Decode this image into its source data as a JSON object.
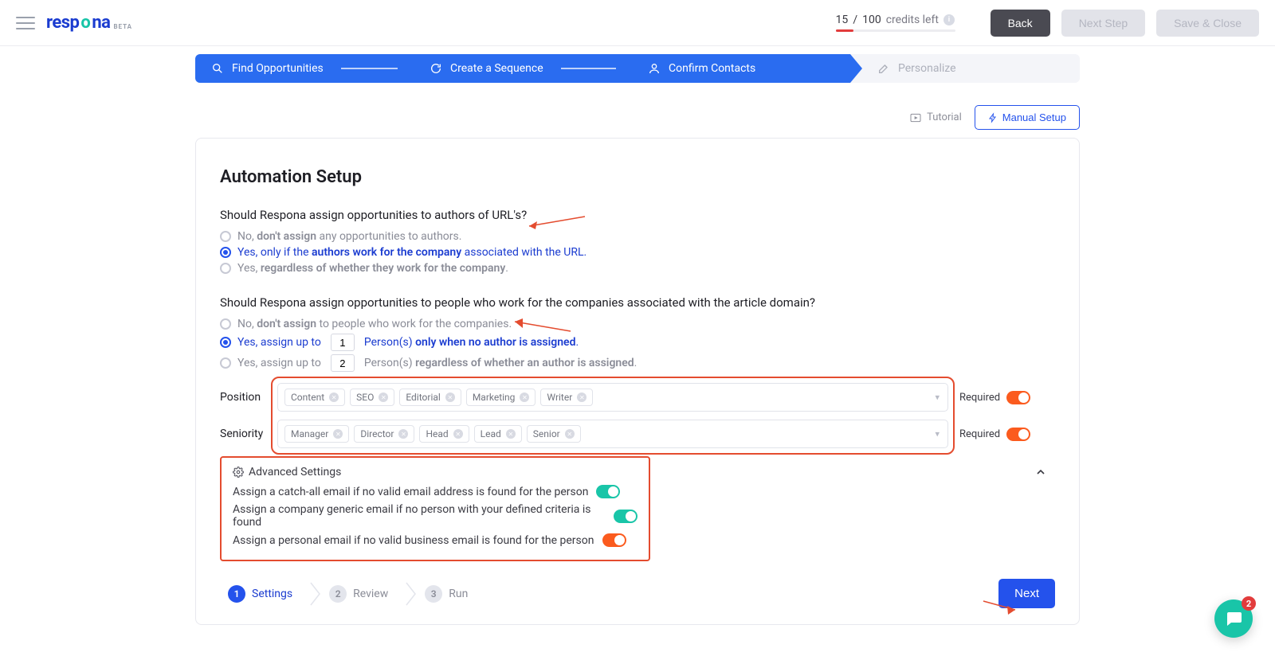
{
  "header": {
    "logo_beta": "BETA",
    "credits_used": "15",
    "credits_total": "100",
    "credits_suffix": "credits left",
    "credits_pct": 15,
    "buttons": {
      "back": "Back",
      "next_step": "Next Step",
      "save_close": "Save & Close"
    }
  },
  "progress": {
    "steps": [
      {
        "label": "Find Opportunities"
      },
      {
        "label": "Create a Sequence"
      },
      {
        "label": "Confirm Contacts"
      },
      {
        "label": "Personalize"
      }
    ]
  },
  "above_card": {
    "tutorial": "Tutorial",
    "manual_setup": "Manual Setup"
  },
  "card": {
    "title": "Automation Setup",
    "q1": {
      "question": "Should Respona assign opportunities to authors of URL's?",
      "opt1_a": "No, ",
      "opt1_b": "don't assign",
      "opt1_c": " any opportunities to authors.",
      "opt2_a": "Yes, only if the ",
      "opt2_b": "authors work for the company",
      "opt2_c": " associated with the URL.",
      "opt3_a": "Yes, ",
      "opt3_b": "regardless of whether they work for the company",
      "opt3_c": "."
    },
    "q2": {
      "question": "Should Respona assign opportunities to people who work for the companies associated with the article domain?",
      "opt1_a": "No, ",
      "opt1_b": "don't assign",
      "opt1_c": " to people who work for the companies.",
      "opt2_a": "Yes, assign up to",
      "opt2_val": "1",
      "opt2_mid": "Person(s) ",
      "opt2_b": "only when no author is assigned",
      "opt2_end": ".",
      "opt3_a": "Yes, assign up to",
      "opt3_val": "2",
      "opt3_mid": "Person(s) ",
      "opt3_b": "regardless of whether an author is assigned",
      "opt3_end": "."
    },
    "position": {
      "label": "Position",
      "tags": [
        "Content",
        "SEO",
        "Editorial",
        "Marketing",
        "Writer"
      ],
      "required_label": "Required"
    },
    "seniority": {
      "label": "Seniority",
      "tags": [
        "Manager",
        "Director",
        "Head",
        "Lead",
        "Senior"
      ],
      "required_label": "Required"
    },
    "advanced": {
      "title": "Advanced Settings",
      "line1": "Assign a catch-all email if no valid email address is found for the person",
      "line2": "Assign a company generic email if no person with your defined criteria is found",
      "line3": "Assign a personal email if no valid business email is found for the person"
    },
    "bottom_steps": {
      "s1": "Settings",
      "s2": "Review",
      "s3": "Run",
      "next": "Next"
    }
  },
  "chat_badge": "2"
}
